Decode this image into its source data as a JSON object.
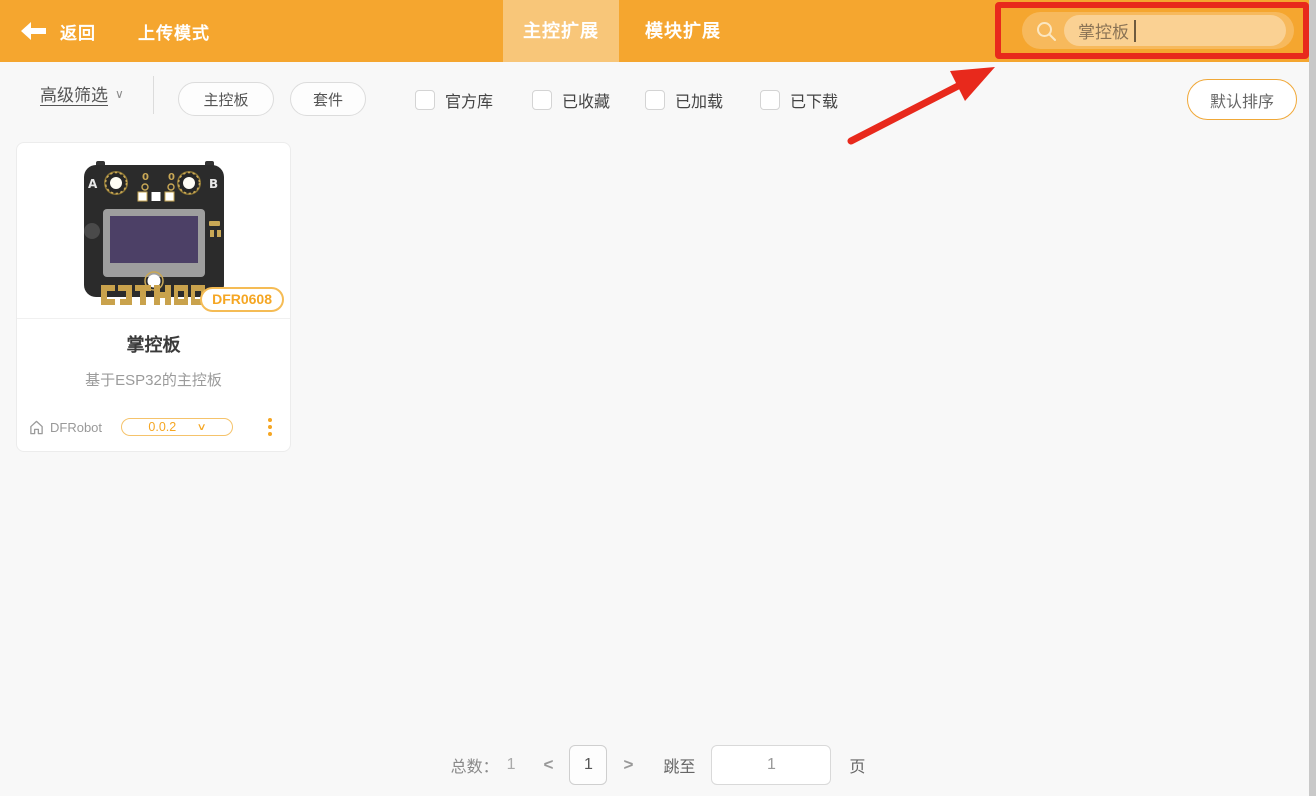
{
  "colors": {
    "accent": "#F5A62F",
    "accent_light": "#F8C679",
    "annotation_red": "#E8291C"
  },
  "header": {
    "back_label": "返回",
    "mode_label": "上传模式",
    "tabs": [
      {
        "label": "主控扩展",
        "active": true
      },
      {
        "label": "模块扩展",
        "active": false
      }
    ],
    "search": {
      "value": "掌控板"
    }
  },
  "filter_bar": {
    "advanced_filter_label": "高级筛选",
    "advanced_filter_chevron": "∨",
    "category_pills": [
      {
        "label": "主控板"
      },
      {
        "label": "套件"
      }
    ],
    "checkboxes": [
      {
        "label": "官方库",
        "checked": false
      },
      {
        "label": "已收藏",
        "checked": false
      },
      {
        "label": "已加载",
        "checked": false
      },
      {
        "label": "已下载",
        "checked": false
      }
    ],
    "sort_button_label": "默认排序"
  },
  "cards": [
    {
      "sku": "DFR0608",
      "title": "掌控板",
      "subtitle": "基于ESP32的主控板",
      "vendor": "DFRobot",
      "version": "0.0.2",
      "version_chevron": "∨"
    }
  ],
  "pagination": {
    "total_label": "总数：",
    "total": "1",
    "prev": "<",
    "current_page": "1",
    "next": ">",
    "jump_label": "跳至",
    "jump_value": "1",
    "page_unit": "页"
  }
}
